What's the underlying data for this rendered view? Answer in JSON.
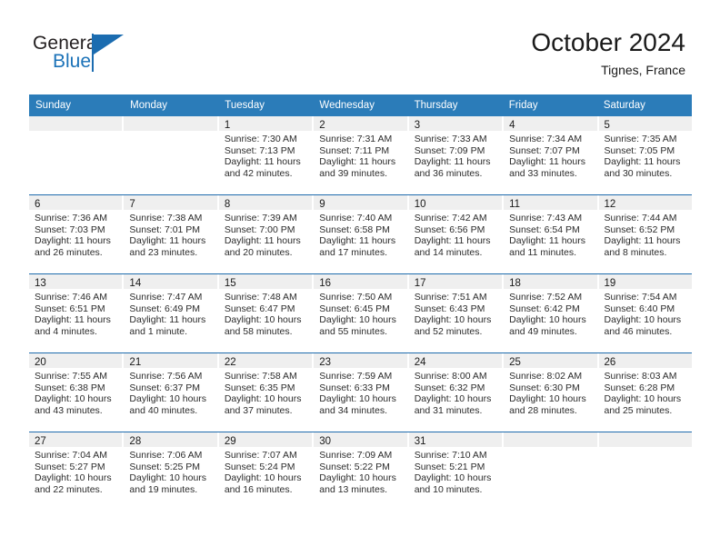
{
  "brand": {
    "name_part1": "General",
    "name_part2": "Blue",
    "accent_color": "#1b6cb0"
  },
  "header": {
    "title": "October 2024",
    "location": "Tignes, France"
  },
  "calendar": {
    "header_bg": "#2b7cb9",
    "row_divider_color": "#1f6cae",
    "daynum_band_color": "#efefef",
    "weekdays": [
      "Sunday",
      "Monday",
      "Tuesday",
      "Wednesday",
      "Thursday",
      "Friday",
      "Saturday"
    ],
    "weeks": [
      [
        {
          "day": "",
          "sunrise": "",
          "sunset": "",
          "daylight_1": "",
          "daylight_2": ""
        },
        {
          "day": "",
          "sunrise": "",
          "sunset": "",
          "daylight_1": "",
          "daylight_2": ""
        },
        {
          "day": "1",
          "sunrise": "Sunrise: 7:30 AM",
          "sunset": "Sunset: 7:13 PM",
          "daylight_1": "Daylight: 11 hours",
          "daylight_2": "and 42 minutes."
        },
        {
          "day": "2",
          "sunrise": "Sunrise: 7:31 AM",
          "sunset": "Sunset: 7:11 PM",
          "daylight_1": "Daylight: 11 hours",
          "daylight_2": "and 39 minutes."
        },
        {
          "day": "3",
          "sunrise": "Sunrise: 7:33 AM",
          "sunset": "Sunset: 7:09 PM",
          "daylight_1": "Daylight: 11 hours",
          "daylight_2": "and 36 minutes."
        },
        {
          "day": "4",
          "sunrise": "Sunrise: 7:34 AM",
          "sunset": "Sunset: 7:07 PM",
          "daylight_1": "Daylight: 11 hours",
          "daylight_2": "and 33 minutes."
        },
        {
          "day": "5",
          "sunrise": "Sunrise: 7:35 AM",
          "sunset": "Sunset: 7:05 PM",
          "daylight_1": "Daylight: 11 hours",
          "daylight_2": "and 30 minutes."
        }
      ],
      [
        {
          "day": "6",
          "sunrise": "Sunrise: 7:36 AM",
          "sunset": "Sunset: 7:03 PM",
          "daylight_1": "Daylight: 11 hours",
          "daylight_2": "and 26 minutes."
        },
        {
          "day": "7",
          "sunrise": "Sunrise: 7:38 AM",
          "sunset": "Sunset: 7:01 PM",
          "daylight_1": "Daylight: 11 hours",
          "daylight_2": "and 23 minutes."
        },
        {
          "day": "8",
          "sunrise": "Sunrise: 7:39 AM",
          "sunset": "Sunset: 7:00 PM",
          "daylight_1": "Daylight: 11 hours",
          "daylight_2": "and 20 minutes."
        },
        {
          "day": "9",
          "sunrise": "Sunrise: 7:40 AM",
          "sunset": "Sunset: 6:58 PM",
          "daylight_1": "Daylight: 11 hours",
          "daylight_2": "and 17 minutes."
        },
        {
          "day": "10",
          "sunrise": "Sunrise: 7:42 AM",
          "sunset": "Sunset: 6:56 PM",
          "daylight_1": "Daylight: 11 hours",
          "daylight_2": "and 14 minutes."
        },
        {
          "day": "11",
          "sunrise": "Sunrise: 7:43 AM",
          "sunset": "Sunset: 6:54 PM",
          "daylight_1": "Daylight: 11 hours",
          "daylight_2": "and 11 minutes."
        },
        {
          "day": "12",
          "sunrise": "Sunrise: 7:44 AM",
          "sunset": "Sunset: 6:52 PM",
          "daylight_1": "Daylight: 11 hours",
          "daylight_2": "and 8 minutes."
        }
      ],
      [
        {
          "day": "13",
          "sunrise": "Sunrise: 7:46 AM",
          "sunset": "Sunset: 6:51 PM",
          "daylight_1": "Daylight: 11 hours",
          "daylight_2": "and 4 minutes."
        },
        {
          "day": "14",
          "sunrise": "Sunrise: 7:47 AM",
          "sunset": "Sunset: 6:49 PM",
          "daylight_1": "Daylight: 11 hours",
          "daylight_2": "and 1 minute."
        },
        {
          "day": "15",
          "sunrise": "Sunrise: 7:48 AM",
          "sunset": "Sunset: 6:47 PM",
          "daylight_1": "Daylight: 10 hours",
          "daylight_2": "and 58 minutes."
        },
        {
          "day": "16",
          "sunrise": "Sunrise: 7:50 AM",
          "sunset": "Sunset: 6:45 PM",
          "daylight_1": "Daylight: 10 hours",
          "daylight_2": "and 55 minutes."
        },
        {
          "day": "17",
          "sunrise": "Sunrise: 7:51 AM",
          "sunset": "Sunset: 6:43 PM",
          "daylight_1": "Daylight: 10 hours",
          "daylight_2": "and 52 minutes."
        },
        {
          "day": "18",
          "sunrise": "Sunrise: 7:52 AM",
          "sunset": "Sunset: 6:42 PM",
          "daylight_1": "Daylight: 10 hours",
          "daylight_2": "and 49 minutes."
        },
        {
          "day": "19",
          "sunrise": "Sunrise: 7:54 AM",
          "sunset": "Sunset: 6:40 PM",
          "daylight_1": "Daylight: 10 hours",
          "daylight_2": "and 46 minutes."
        }
      ],
      [
        {
          "day": "20",
          "sunrise": "Sunrise: 7:55 AM",
          "sunset": "Sunset: 6:38 PM",
          "daylight_1": "Daylight: 10 hours",
          "daylight_2": "and 43 minutes."
        },
        {
          "day": "21",
          "sunrise": "Sunrise: 7:56 AM",
          "sunset": "Sunset: 6:37 PM",
          "daylight_1": "Daylight: 10 hours",
          "daylight_2": "and 40 minutes."
        },
        {
          "day": "22",
          "sunrise": "Sunrise: 7:58 AM",
          "sunset": "Sunset: 6:35 PM",
          "daylight_1": "Daylight: 10 hours",
          "daylight_2": "and 37 minutes."
        },
        {
          "day": "23",
          "sunrise": "Sunrise: 7:59 AM",
          "sunset": "Sunset: 6:33 PM",
          "daylight_1": "Daylight: 10 hours",
          "daylight_2": "and 34 minutes."
        },
        {
          "day": "24",
          "sunrise": "Sunrise: 8:00 AM",
          "sunset": "Sunset: 6:32 PM",
          "daylight_1": "Daylight: 10 hours",
          "daylight_2": "and 31 minutes."
        },
        {
          "day": "25",
          "sunrise": "Sunrise: 8:02 AM",
          "sunset": "Sunset: 6:30 PM",
          "daylight_1": "Daylight: 10 hours",
          "daylight_2": "and 28 minutes."
        },
        {
          "day": "26",
          "sunrise": "Sunrise: 8:03 AM",
          "sunset": "Sunset: 6:28 PM",
          "daylight_1": "Daylight: 10 hours",
          "daylight_2": "and 25 minutes."
        }
      ],
      [
        {
          "day": "27",
          "sunrise": "Sunrise: 7:04 AM",
          "sunset": "Sunset: 5:27 PM",
          "daylight_1": "Daylight: 10 hours",
          "daylight_2": "and 22 minutes."
        },
        {
          "day": "28",
          "sunrise": "Sunrise: 7:06 AM",
          "sunset": "Sunset: 5:25 PM",
          "daylight_1": "Daylight: 10 hours",
          "daylight_2": "and 19 minutes."
        },
        {
          "day": "29",
          "sunrise": "Sunrise: 7:07 AM",
          "sunset": "Sunset: 5:24 PM",
          "daylight_1": "Daylight: 10 hours",
          "daylight_2": "and 16 minutes."
        },
        {
          "day": "30",
          "sunrise": "Sunrise: 7:09 AM",
          "sunset": "Sunset: 5:22 PM",
          "daylight_1": "Daylight: 10 hours",
          "daylight_2": "and 13 minutes."
        },
        {
          "day": "31",
          "sunrise": "Sunrise: 7:10 AM",
          "sunset": "Sunset: 5:21 PM",
          "daylight_1": "Daylight: 10 hours",
          "daylight_2": "and 10 minutes."
        },
        {
          "day": "",
          "sunrise": "",
          "sunset": "",
          "daylight_1": "",
          "daylight_2": ""
        },
        {
          "day": "",
          "sunrise": "",
          "sunset": "",
          "daylight_1": "",
          "daylight_2": ""
        }
      ]
    ]
  }
}
